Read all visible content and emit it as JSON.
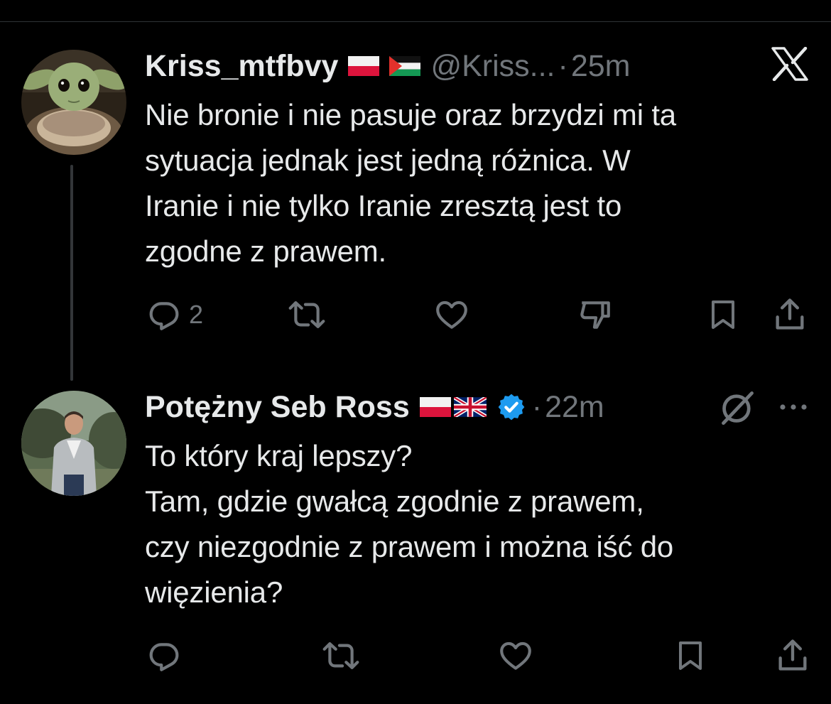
{
  "tweets": [
    {
      "name": "Kriss_mtfbvy",
      "handle": "@Kriss...",
      "separator": "·",
      "time": "25m",
      "lines": [
        "Nie bronie i nie pasuje oraz brzydzi mi ta",
        "sytuacja jednak jest jedną różnica. W",
        "Iranie i nie tylko Iranie zresztą jest to",
        "zgodne z prawem."
      ],
      "reply_count": "2",
      "flags": [
        "poland-flag",
        "palestine-flag"
      ],
      "avatar": "baby-yoda-avatar",
      "corner_icon": "x-logo-icon"
    },
    {
      "name": "Potężny Seb Ross",
      "separator": "·",
      "time": "22m",
      "lines": [
        "To który kraj lepszy?",
        "Tam, gdzie gwałcą zgodnie z prawem,",
        "czy niezgodnie z prawem i można iść do",
        "więzienia?"
      ],
      "reply_count": "",
      "flags": [
        "poland-flag",
        "uk-flag"
      ],
      "verified": true,
      "avatar": "man-in-suit-avatar",
      "corner_icons": [
        "grok-icon",
        "more-icon"
      ]
    }
  ],
  "colors": {
    "background": "#000000",
    "text": "#e7e9ea",
    "muted": "#71767b",
    "verified": "#1d9bf0",
    "divider": "#2f3336"
  }
}
